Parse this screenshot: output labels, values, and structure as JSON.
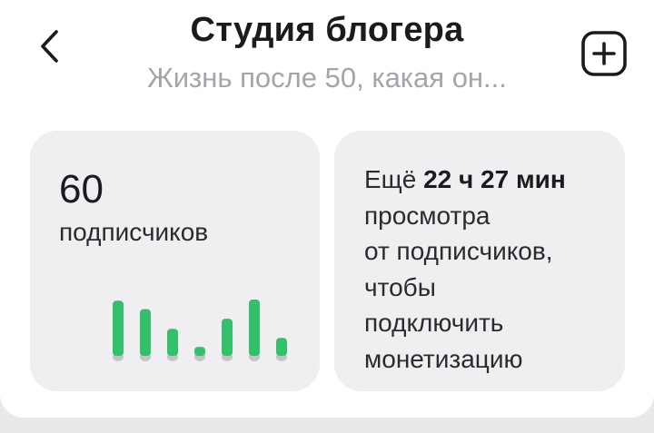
{
  "header": {
    "title": "Студия блогера",
    "subtitle": "Жизнь после 50, какая он..."
  },
  "subscribers": {
    "count": "60",
    "label": "подписчиков",
    "chart_data": {
      "type": "bar",
      "values": [
        0.92,
        0.78,
        0.45,
        0.15,
        0.62,
        0.94,
        0.3
      ],
      "bar_color": "#33c06b",
      "base_color": "#c4c4c8"
    }
  },
  "monetization": {
    "prefix": "Ещё ",
    "time": "22 ч 27 мин",
    "lines": [
      "просмотра",
      "от подписчиков,",
      "чтобы",
      "подключить",
      "монетизацию"
    ]
  },
  "colors": {
    "accent": "#33c06b",
    "card_bg": "#efeff1",
    "text": "#1b1b1f",
    "muted": "#a4a4aa"
  },
  "icons": {
    "back": "chevron-left-icon",
    "add": "plus-square-icon"
  }
}
